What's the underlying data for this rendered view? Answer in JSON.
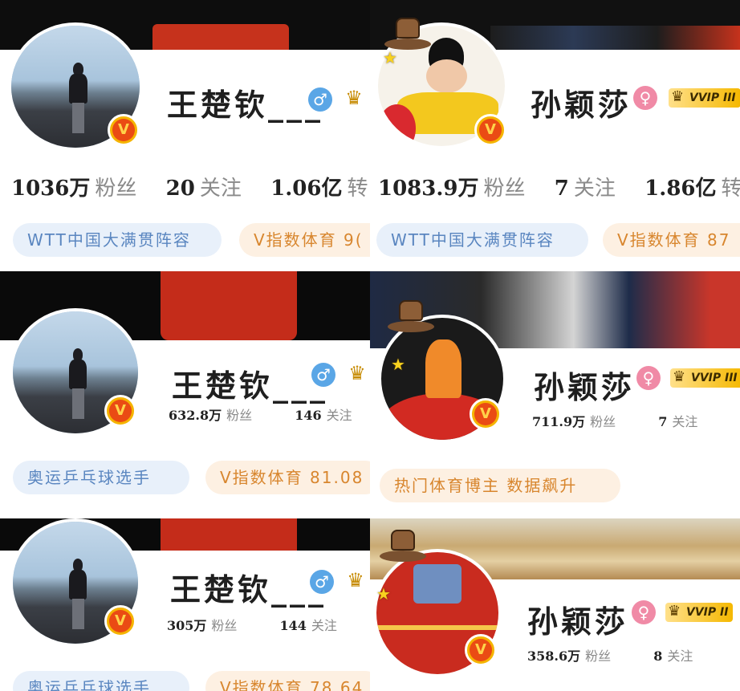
{
  "panels": [
    {
      "name": "王楚钦___",
      "gender_symbol": "♂",
      "crown": "♛",
      "vip": "",
      "stats": [
        {
          "num": "1036万",
          "label": "粉丝"
        },
        {
          "num": "20",
          "label": "关注"
        },
        {
          "num": "1.06亿",
          "label": "转"
        }
      ],
      "tags": [
        "WTT中国大满贯阵容",
        "V指数体育 9("
      ]
    },
    {
      "name": "孙颖莎",
      "gender_symbol": "♀",
      "crown": "♛",
      "vip": "VVIP III",
      "stats": [
        {
          "num": "1083.9万",
          "label": "粉丝"
        },
        {
          "num": "7",
          "label": "关注"
        },
        {
          "num": "1.86亿",
          "label": "转"
        }
      ],
      "tags": [
        "WTT中国大满贯阵容",
        "V指数体育 87"
      ]
    },
    {
      "name": "王楚钦___",
      "gender_symbol": "♂",
      "crown": "♛",
      "vip": "",
      "stats": [
        {
          "num": "632.8万",
          "label": "粉丝"
        },
        {
          "num": "146",
          "label": "关注"
        }
      ],
      "tags": [
        "奥运乒乓球选手",
        "V指数体育 81.08"
      ]
    },
    {
      "name": "孙颖莎",
      "gender_symbol": "♀",
      "crown": "♛",
      "vip": "VVIP III",
      "stats": [
        {
          "num": "711.9万",
          "label": "粉丝"
        },
        {
          "num": "7",
          "label": "关注"
        }
      ],
      "tags": [
        "热门体育博主 数据飙升"
      ]
    },
    {
      "name": "王楚钦___",
      "gender_symbol": "♂",
      "crown": "♛",
      "vip": "",
      "stats": [
        {
          "num": "305万",
          "label": "粉丝"
        },
        {
          "num": "144",
          "label": "关注"
        }
      ],
      "tags": [
        "奥运乒乓球选手",
        "V指数体育 78.64"
      ]
    },
    {
      "name": "孙颖莎",
      "gender_symbol": "♀",
      "crown": "♛",
      "vip": "VVIP II",
      "stats": [
        {
          "num": "358.6万",
          "label": "粉丝"
        },
        {
          "num": "8",
          "label": "关注"
        }
      ]
    }
  ],
  "badge_letter": "V",
  "colors": {
    "male": "#5aa6e6",
    "female": "#f08aa6",
    "tag_blue": "#5a86c0",
    "tag_orange": "#d8862e",
    "vip_gold": "#f5b800"
  },
  "icons": [
    "male-icon",
    "female-icon",
    "crown-icon",
    "verified-v-icon",
    "hat-badge-icon",
    "star-icon"
  ]
}
